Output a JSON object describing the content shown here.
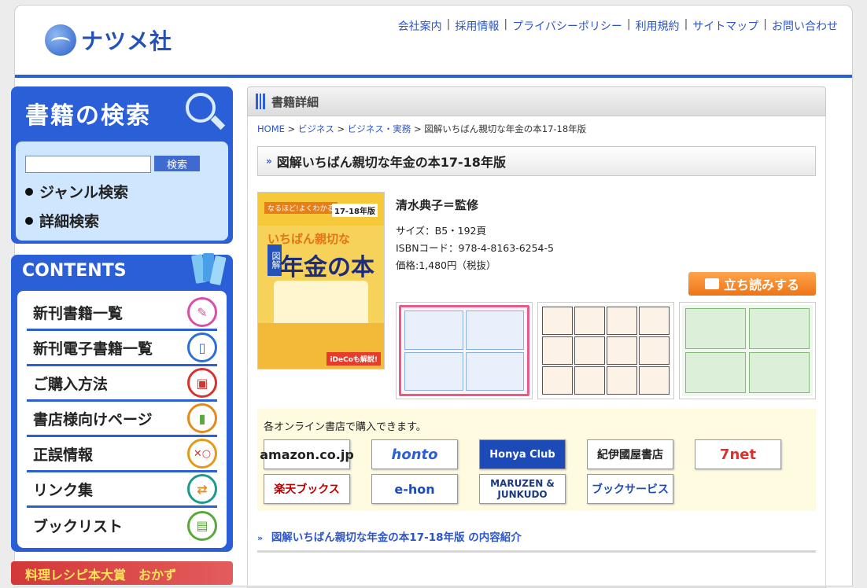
{
  "logo": {
    "text": "ナツメ社"
  },
  "topnav": {
    "items": [
      "会社案内",
      "採用情報",
      "プライバシーポリシー",
      "利用規約",
      "サイトマップ",
      "お問い合わせ"
    ]
  },
  "sidebar": {
    "search_title": "書籍の検索",
    "search_button": "検索",
    "search_value": "",
    "links": [
      "ジャンル検索",
      "詳細検索"
    ],
    "contents_title": "CONTENTS",
    "menu": [
      {
        "label": "新刊書籍一覧",
        "icon": "new-book-icon",
        "color": "#d94fa8",
        "glyph": "✎"
      },
      {
        "label": "新刊電子書籍一覧",
        "icon": "tablet-icon",
        "color": "#2b6fd8",
        "glyph": "▯"
      },
      {
        "label": "ご購入方法",
        "icon": "cart-icon",
        "color": "#d7332f",
        "glyph": "🛒"
      },
      {
        "label": "書店様向けページ",
        "icon": "bookstore-icon",
        "color": "#e38a1b",
        "glyph": "📖"
      },
      {
        "label": "正誤情報",
        "icon": "correct-wrong-icon",
        "color": "#e39a1b",
        "glyph": "✕○"
      },
      {
        "label": "リンク集",
        "icon": "exchange-icon",
        "color": "#1c9a8a",
        "glyph": "⇄"
      },
      {
        "label": "ブックリスト",
        "icon": "clipboard-icon",
        "color": "#5aa83c",
        "glyph": "▤"
      }
    ],
    "banner": "料理レシピ本大賞　おかず"
  },
  "main": {
    "section_title": "書籍詳細",
    "breadcrumb": [
      "HOME",
      "ビジネス",
      "ビジネス・実務",
      "図解いちばん親切な年金の本17-18年版"
    ],
    "book_title": "図解いちばん親切な年金の本17-18年版",
    "author": "清水典子＝監修",
    "size": "サイズ：B5・192頁",
    "isbn": "ISBNコード：978-4-8163-6254-5",
    "price": "価格:1,480円（税抜）",
    "tachiyomi": "立ち読みする",
    "cover": {
      "band": "なるほど!よくわかる",
      "year": "17-18年版",
      "title_1": "いちばん親切な",
      "title_2": "年金の本",
      "zukai": "図解",
      "badge": "iDeCoも解説!"
    },
    "shops_label": "各オンライン書店で購入できます。",
    "shops": [
      "amazon.co.jp",
      "honto",
      "Honya Club",
      "紀伊國屋書店",
      "7net",
      "楽天ブックス",
      "e-hon",
      "MARUZEN & JUNKUDO",
      "ブックサービス"
    ],
    "intro": "図解いちばん親切な年金の本17-18年版 の内容紹介"
  }
}
